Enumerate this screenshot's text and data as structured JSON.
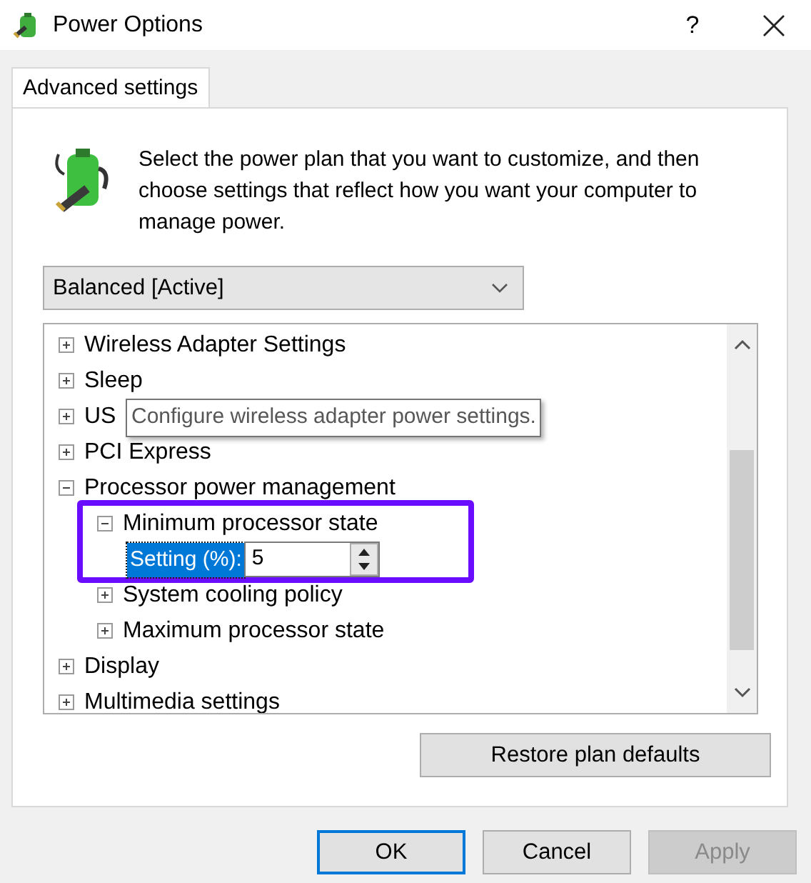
{
  "window": {
    "title": "Power Options",
    "help": "?"
  },
  "tabs": [
    {
      "label": "Advanced settings",
      "selected": true
    }
  ],
  "description": "Select the power plan that you want to customize, and then choose settings that reflect how you want your computer to manage power.",
  "plan_dropdown": {
    "value": "Balanced [Active]"
  },
  "tree": [
    {
      "kind": "node",
      "label": "Wireless Adapter Settings",
      "expanded": false
    },
    {
      "kind": "node",
      "label": "Sleep",
      "expanded": false
    },
    {
      "kind": "node",
      "label": "US",
      "expanded": false
    },
    {
      "kind": "node",
      "label": "PCI Express",
      "expanded": false
    },
    {
      "kind": "node",
      "label": "Processor power management",
      "expanded": true,
      "children": [
        {
          "kind": "node",
          "label": "Minimum processor state",
          "expanded": true,
          "highlighted": true,
          "children": [
            {
              "kind": "setting",
              "label": "Setting (%):",
              "value": "5",
              "selected": true
            }
          ]
        },
        {
          "kind": "node",
          "label": "System cooling policy",
          "expanded": false
        },
        {
          "kind": "node",
          "label": "Maximum processor state",
          "expanded": false
        }
      ]
    },
    {
      "kind": "node",
      "label": "Display",
      "expanded": false
    },
    {
      "kind": "node",
      "label": "Multimedia settings",
      "expanded": false
    }
  ],
  "tooltip": "Configure wireless adapter power settings.",
  "restore_button": "Restore plan defaults",
  "buttons": [
    {
      "label": "OK",
      "default": true,
      "disabled": false
    },
    {
      "label": "Cancel",
      "default": false,
      "disabled": false
    },
    {
      "label": "Apply",
      "default": false,
      "disabled": true
    }
  ]
}
